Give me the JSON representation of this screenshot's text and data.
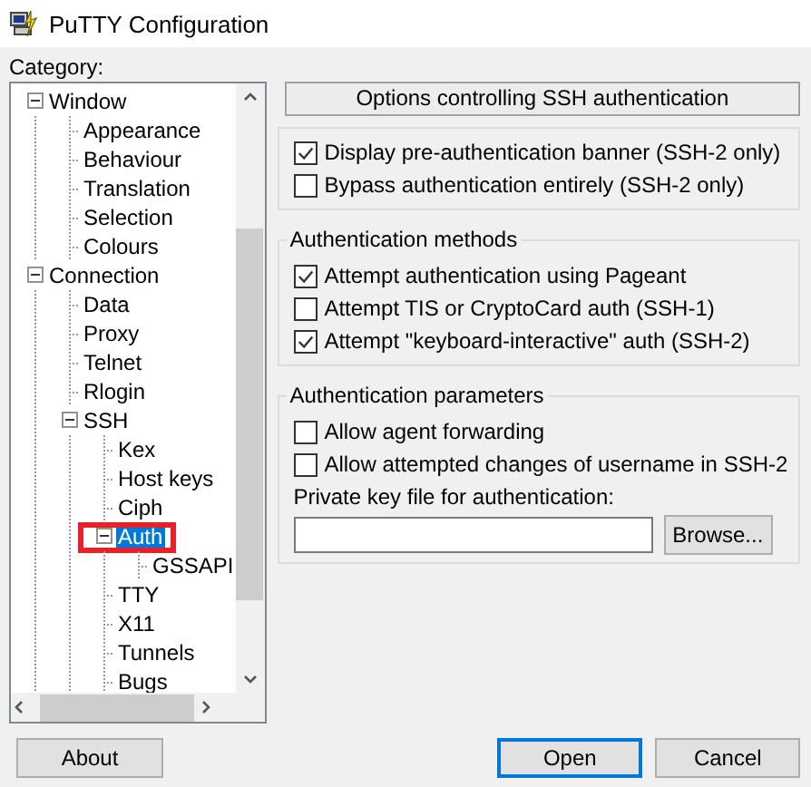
{
  "window": {
    "title": "PuTTY Configuration"
  },
  "category_label": "Category:",
  "tree": [
    {
      "label": "Window",
      "expanded": true,
      "selected": false,
      "children": [
        {
          "label": "Appearance",
          "selected": false
        },
        {
          "label": "Behaviour",
          "selected": false
        },
        {
          "label": "Translation",
          "selected": false
        },
        {
          "label": "Selection",
          "selected": false
        },
        {
          "label": "Colours",
          "selected": false
        }
      ]
    },
    {
      "label": "Connection",
      "expanded": true,
      "selected": false,
      "children": [
        {
          "label": "Data",
          "selected": false
        },
        {
          "label": "Proxy",
          "selected": false
        },
        {
          "label": "Telnet",
          "selected": false
        },
        {
          "label": "Rlogin",
          "selected": false
        },
        {
          "label": "SSH",
          "expanded": true,
          "selected": false,
          "children": [
            {
              "label": "Kex",
              "selected": false
            },
            {
              "label": "Host keys",
              "selected": false
            },
            {
              "label": "Ciph",
              "selected": false
            },
            {
              "label": "Auth",
              "expanded": true,
              "selected": true,
              "highlighted": true,
              "children": [
                {
                  "label": "GSSAPI",
                  "selected": false
                }
              ]
            },
            {
              "label": "TTY",
              "selected": false
            },
            {
              "label": "X11",
              "selected": false
            },
            {
              "label": "Tunnels",
              "selected": false
            },
            {
              "label": "Bugs",
              "selected": false
            }
          ]
        }
      ]
    }
  ],
  "panel": {
    "header": "Options controlling SSH authentication",
    "groups": [
      {
        "items": [
          {
            "label": "Display pre-authentication banner (SSH-2 only)",
            "checked": true
          },
          {
            "label": "Bypass authentication entirely (SSH-2 only)",
            "checked": false
          }
        ]
      },
      {
        "title": "Authentication methods",
        "items": [
          {
            "label": "Attempt authentication using Pageant",
            "checked": true
          },
          {
            "label": "Attempt TIS or CryptoCard auth (SSH-1)",
            "checked": false
          },
          {
            "label": "Attempt \"keyboard-interactive\" auth (SSH-2)",
            "checked": true
          }
        ]
      },
      {
        "title": "Authentication parameters",
        "items": [
          {
            "label": "Allow agent forwarding",
            "checked": false
          },
          {
            "label": "Allow attempted changes of username in SSH-2",
            "checked": false
          }
        ],
        "field": {
          "label": "Private key file for authentication:",
          "button": "Browse..."
        }
      }
    ]
  },
  "buttons": {
    "about": "About",
    "open": "Open",
    "cancel": "Cancel"
  }
}
